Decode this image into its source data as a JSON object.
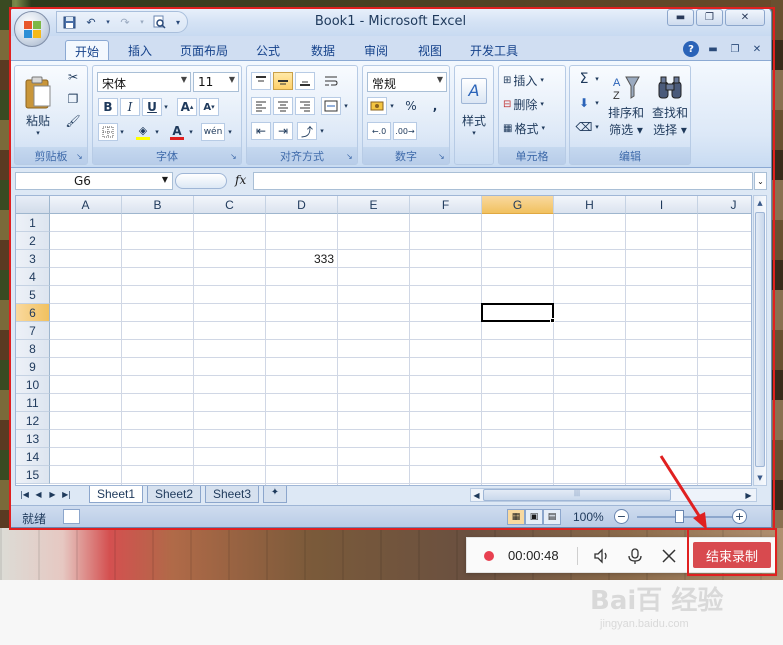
{
  "window": {
    "title": "Book1 - Microsoft Excel",
    "minimize": "▬",
    "restore": "❐",
    "close": "✕"
  },
  "tabs": [
    "开始",
    "插入",
    "页面布局",
    "公式",
    "数据",
    "审阅",
    "视图",
    "开发工具"
  ],
  "ribbon": {
    "clipboard": {
      "paste": "粘贴",
      "label": "剪贴板"
    },
    "font": {
      "name": "宋体",
      "size": "11",
      "label": "字体",
      "bold": "B",
      "italic": "I",
      "underline": "U"
    },
    "alignment": {
      "label": "对齐方式"
    },
    "number": {
      "format": "常规",
      "label": "数字",
      "percent": "%",
      "comma": ","
    },
    "styles": {
      "label": "样式"
    },
    "cells": {
      "insert": "插入",
      "delete": "删除",
      "format": "格式",
      "label": "单元格"
    },
    "editing": {
      "sigma": "Σ",
      "sort": "排序和",
      "sort2": "筛选",
      "find": "查找和",
      "find2": "选择",
      "label": "编辑"
    }
  },
  "formula_bar": {
    "name_box": "G6",
    "fx": "fx",
    "value": ""
  },
  "grid": {
    "columns": [
      "A",
      "B",
      "C",
      "D",
      "E",
      "F",
      "G",
      "H",
      "I",
      "J"
    ],
    "rows": [
      "1",
      "2",
      "3",
      "4",
      "5",
      "6",
      "7",
      "8",
      "9",
      "10",
      "11",
      "12",
      "13",
      "14",
      "15"
    ],
    "selected_column": "G",
    "selected_row": "6",
    "cells": [
      {
        "ref": "D3",
        "value": "333"
      }
    ]
  },
  "sheets": [
    "Sheet1",
    "Sheet2",
    "Sheet3"
  ],
  "status": {
    "ready": "就绪",
    "zoom": "100%",
    "minus": "−",
    "plus": "+"
  },
  "recorder": {
    "time": "00:00:48",
    "end_label": "结束录制"
  },
  "watermark": {
    "brand": "Bai百 经验",
    "url": "jingyan.baidu.com"
  },
  "colors": {
    "accent": "#15428b",
    "selection": "#f1c15f",
    "record_red": "#d84a4f",
    "annotation_red": "#e02020"
  }
}
